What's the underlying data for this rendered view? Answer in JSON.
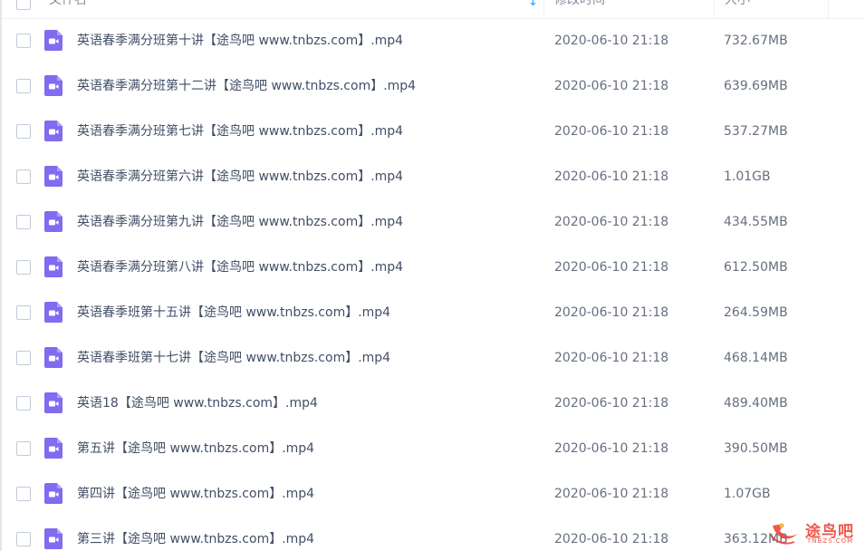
{
  "header": {
    "name_label": "文件名",
    "time_label": "修改时间",
    "size_label": "大小",
    "sort_icon": "sort-arrow-down-icon"
  },
  "files": [
    {
      "name": "英语春季满分班第十讲【途鸟吧 www.tnbzs.com】.mp4",
      "time": "2020-06-10 21:18",
      "size": "732.67MB"
    },
    {
      "name": "英语春季满分班第十二讲【途鸟吧 www.tnbzs.com】.mp4",
      "time": "2020-06-10 21:18",
      "size": "639.69MB"
    },
    {
      "name": "英语春季满分班第七讲【途鸟吧 www.tnbzs.com】.mp4",
      "time": "2020-06-10 21:18",
      "size": "537.27MB"
    },
    {
      "name": "英语春季满分班第六讲【途鸟吧 www.tnbzs.com】.mp4",
      "time": "2020-06-10 21:18",
      "size": "1.01GB"
    },
    {
      "name": "英语春季满分班第九讲【途鸟吧 www.tnbzs.com】.mp4",
      "time": "2020-06-10 21:18",
      "size": "434.55MB"
    },
    {
      "name": "英语春季满分班第八讲【途鸟吧 www.tnbzs.com】.mp4",
      "time": "2020-06-10 21:18",
      "size": "612.50MB"
    },
    {
      "name": "英语春季班第十五讲【途鸟吧 www.tnbzs.com】.mp4",
      "time": "2020-06-10 21:18",
      "size": "264.59MB"
    },
    {
      "name": "英语春季班第十七讲【途鸟吧 www.tnbzs.com】.mp4",
      "time": "2020-06-10 21:18",
      "size": "468.14MB"
    },
    {
      "name": "英语18【途鸟吧 www.tnbzs.com】.mp4",
      "time": "2020-06-10 21:18",
      "size": "489.40MB"
    },
    {
      "name": "第五讲【途鸟吧 www.tnbzs.com】.mp4",
      "time": "2020-06-10 21:18",
      "size": "390.50MB"
    },
    {
      "name": "第四讲【途鸟吧 www.tnbzs.com】.mp4",
      "time": "2020-06-10 21:18",
      "size": "1.07GB"
    },
    {
      "name": "第三讲【途鸟吧 www.tnbzs.com】.mp4",
      "time": "2020-06-10 21:18",
      "size": "363.12MB"
    }
  ],
  "watermark": {
    "text": "途鸟吧",
    "sub": "TNBZS.COM"
  },
  "colors": {
    "icon_fill": "#7f6cf0",
    "sort_arrow": "#09aaff",
    "watermark": "#ee3a2c"
  }
}
